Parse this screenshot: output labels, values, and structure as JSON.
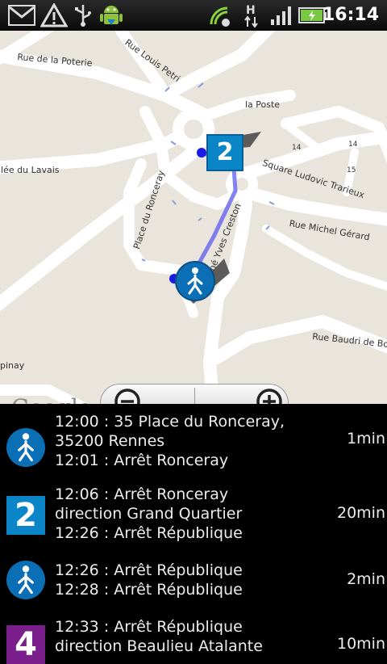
{
  "status_bar": {
    "time": "16:14",
    "icons": [
      "gmail-icon",
      "warning-icon",
      "usb-icon",
      "android-debug-icon",
      "wifi-sync-icon",
      "hspa-icon",
      "signal-icon",
      "battery-icon"
    ]
  },
  "map": {
    "streets": [
      "Rue de la Poterie",
      "Rue Louis Petri",
      "la Poste",
      "llée du Lavais",
      "Square Ludovic Trarieux",
      "Place du Ronceray",
      "Rue Michel Gérard",
      "Rue René Yves Creston",
      "Rue Baudri de Bou",
      "pinay"
    ],
    "house_numbers": [
      "14",
      "15",
      "14"
    ],
    "bus_marker_label": "2",
    "google_logo": "Google",
    "route_color": "#5a5af0"
  },
  "itinerary": [
    {
      "icon": "walk-icon",
      "lines": [
        "12:00 : 35 Place du Ronceray,",
        "35200 Rennes",
        "12:01 : Arrêt Ronceray"
      ],
      "duration": "1min"
    },
    {
      "icon": "bus-line-icon",
      "badge": "2",
      "lines": [
        "12:06 : Arrêt Ronceray",
        "direction Grand Quartier",
        "12:26 : Arrêt République"
      ],
      "duration": "20min"
    },
    {
      "icon": "walk-icon",
      "lines": [
        "12:26 : Arrêt République",
        "12:28 : Arrêt République"
      ],
      "duration": "2min"
    },
    {
      "icon": "bus-line-icon",
      "badge": "4",
      "lines": [
        "12:33 : Arrêt République",
        "direction Beaulieu Atalante"
      ],
      "duration": "10min"
    }
  ]
}
